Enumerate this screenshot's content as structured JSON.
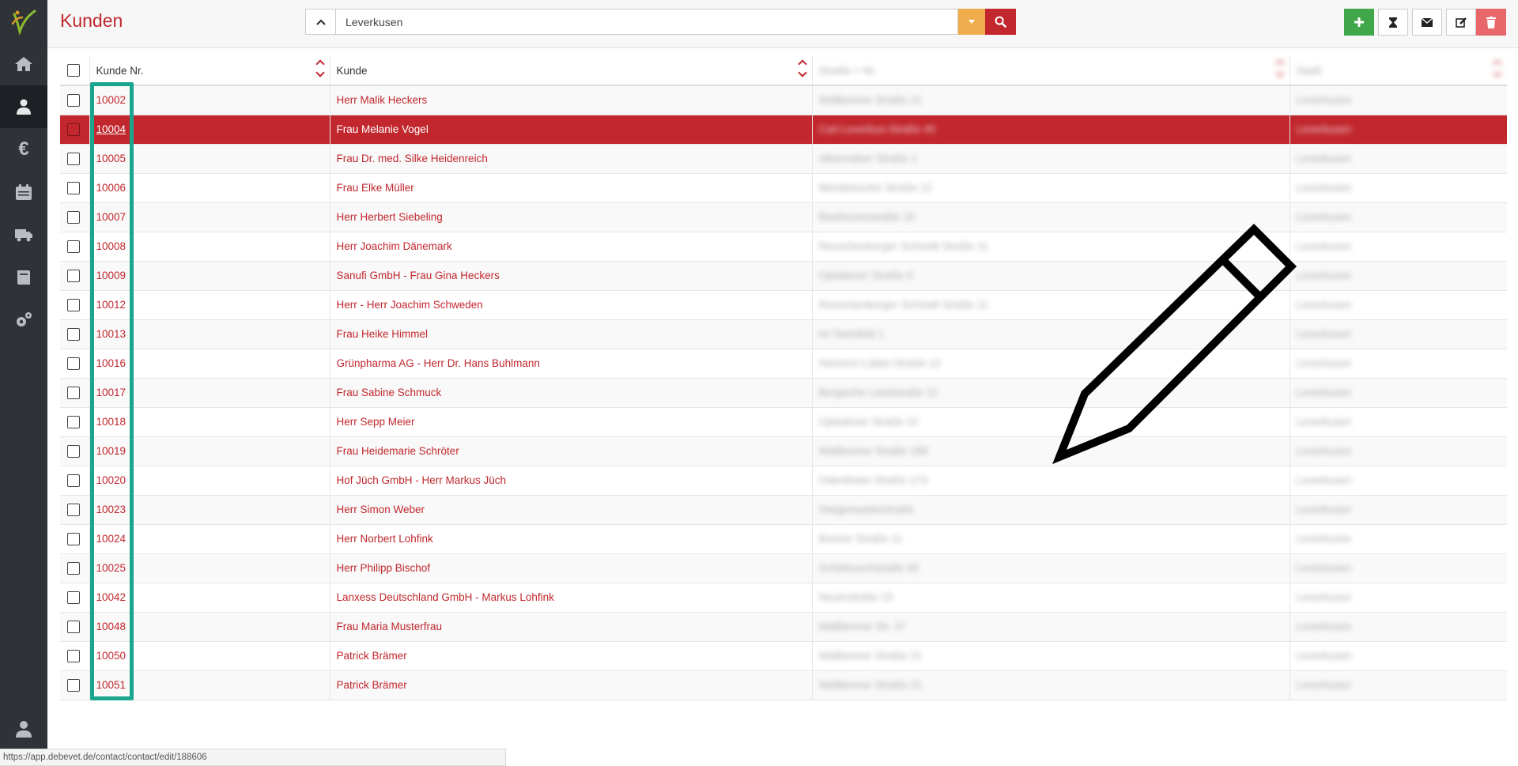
{
  "sidebar": {
    "logo": "debevet-logo",
    "items": [
      {
        "icon": "home-icon"
      },
      {
        "icon": "customers-icon",
        "active": true
      },
      {
        "icon": "euro-icon"
      },
      {
        "icon": "calendar-icon"
      },
      {
        "icon": "truck-icon"
      },
      {
        "icon": "book-icon"
      },
      {
        "icon": "settings-icon"
      }
    ],
    "user_icon": "user-icon"
  },
  "header": {
    "title": "Kunden",
    "search": {
      "value": "Leverkusen",
      "placeholder": ""
    },
    "toolbar": [
      "add-icon",
      "hourglass-icon",
      "mail-icon",
      "edit-icon",
      "trash-icon"
    ]
  },
  "colors": {
    "brand": "#c1272d",
    "warning": "#f0ad4e",
    "success": "#3fa64a",
    "highlight": "#1aa58f"
  },
  "table": {
    "columns": {
      "nr": "Kunde Nr.",
      "name": "Kunde",
      "street": "Straße + Nr.",
      "city": "Stadt"
    },
    "rows": [
      {
        "nr": "10002",
        "name": "Herr Malik Heckers",
        "street": "Wallbenner Straße 21",
        "city": "Leverkusen"
      },
      {
        "nr": "10004",
        "name": "Frau Melanie Vogel",
        "street": "Carl-Leverkus-Straße 45",
        "city": "Leverkusen",
        "selected": true
      },
      {
        "nr": "10005",
        "name": "Frau Dr. med. Silke Heidenreich",
        "street": "Alkenrather Straße 1",
        "city": "Leverkusen"
      },
      {
        "nr": "10006",
        "name": "Frau Elke Müller",
        "street": "Mendelssohn Straße 12",
        "city": "Leverkusen"
      },
      {
        "nr": "10007",
        "name": "Herr Herbert Siebeling",
        "street": "Beethovenstraße 16",
        "city": "Leverkusen"
      },
      {
        "nr": "10008",
        "name": "Herr Joachim Dänemark",
        "street": "Reuschenberger Schmidt Straße 11",
        "city": "Leverkusen"
      },
      {
        "nr": "10009",
        "name": "Sanufi GmbH - Frau Gina Heckers",
        "street": "Opladener Straße 9",
        "city": "Leverkusen"
      },
      {
        "nr": "10012",
        "name": "Herr - Herr Joachim Schweden",
        "street": "Reuschenberger Schmidt Straße 11",
        "city": "Leverkusen"
      },
      {
        "nr": "10013",
        "name": "Frau Heike Himmel",
        "street": "Im Steinfeld 1",
        "city": "Leverkusen"
      },
      {
        "nr": "10016",
        "name": "Grünpharma AG - Herr Dr. Hans Buhlmann",
        "street": "Heinrich-Lübke-Straße 12",
        "city": "Leverkusen"
      },
      {
        "nr": "10017",
        "name": "Frau Sabine Schmuck",
        "street": "Bergische Landstraße 12",
        "city": "Leverkusen"
      },
      {
        "nr": "10018",
        "name": "Herr Sepp Meier",
        "street": "Opladener Straße 22",
        "city": "Leverkusen"
      },
      {
        "nr": "10019",
        "name": "Frau Heidemarie Schröter",
        "street": "Wallbenner Straße 188",
        "city": "Leverkusen"
      },
      {
        "nr": "10020",
        "name": "Hof Jüch GmbH - Herr Markus Jüch",
        "street": "Odenthaler Straße 174",
        "city": "Leverkusen"
      },
      {
        "nr": "10023",
        "name": "Herr Simon Weber",
        "street": "Steigenweberstraße",
        "city": "Leverkusen"
      },
      {
        "nr": "10024",
        "name": "Herr Norbert Lohfink",
        "street": "Bonner Straße 11",
        "city": "Leverkusen"
      },
      {
        "nr": "10025",
        "name": "Herr Philipp Bischof",
        "street": "Schlebuschstraße 45",
        "city": "Leverkusen"
      },
      {
        "nr": "10042",
        "name": "Lanxess Deutschland GmbH - Markus Lohfink",
        "street": "Neuerstraße 15",
        "city": "Leverkusen"
      },
      {
        "nr": "10048",
        "name": "Frau Maria Musterfrau",
        "street": "Wallbenner Str. 37",
        "city": "Leverkusen"
      },
      {
        "nr": "10050",
        "name": "Patrick Brämer",
        "street": "Wallbenner Straße 21",
        "city": "Leverkusen"
      },
      {
        "nr": "10051",
        "name": "Patrick Brämer",
        "street": "Wallbenner Straße 21",
        "city": "Leverkusen"
      }
    ]
  },
  "statusbar": {
    "url": "https://app.debevet.de/contact/contact/edit/188606"
  }
}
